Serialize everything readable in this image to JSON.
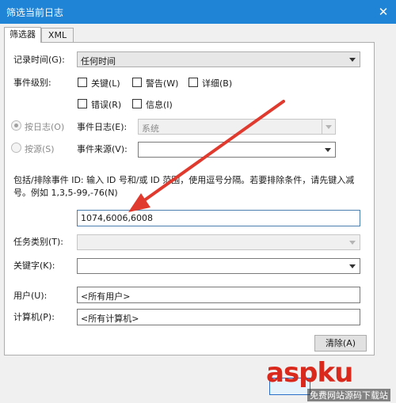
{
  "window": {
    "title": "筛选当前日志",
    "close_glyph": "✕"
  },
  "tabs": {
    "filter": "筛选器",
    "xml": "XML"
  },
  "logged": {
    "label": "记录时间(G):",
    "value": "任何时间"
  },
  "level": {
    "label": "事件级别:",
    "critical": "关键(L)",
    "warning": "警告(W)",
    "verbose": "详细(B)",
    "error": "错误(R)",
    "info": "信息(I)"
  },
  "by_log": {
    "radio_label": "按日志(O)",
    "field_label": "事件日志(E):",
    "value": "系统"
  },
  "by_source": {
    "radio_label": "按源(S)",
    "field_label": "事件来源(V):",
    "value": ""
  },
  "event_ids": {
    "hint": "包括/排除事件 ID: 输入 ID 号和/或 ID 范围，使用逗号分隔。若要排除条件，请先键入减号。例如 1,3,5-99,-76(N)",
    "value": "1074,6006,6008"
  },
  "task_category": {
    "label": "任务类别(T):",
    "value": ""
  },
  "keywords": {
    "label": "关键字(K):",
    "value": ""
  },
  "user": {
    "label": "用户(U):",
    "value": "<所有用户>"
  },
  "computer": {
    "label": "计算机(P):",
    "value": "<所有计算机>"
  },
  "buttons": {
    "clear": "清除(A)"
  },
  "watermark": {
    "brand": "aspku",
    "sub": "免费网站源码下载站"
  },
  "colors": {
    "titlebar": "#1f83d6",
    "annotation_arrow": "#e03a2e"
  }
}
